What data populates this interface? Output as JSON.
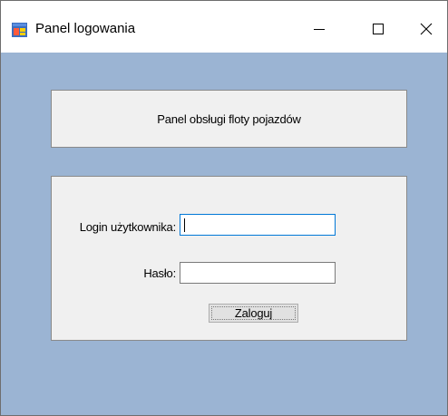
{
  "window": {
    "title": "Panel logowania",
    "icon": "windows-forms-app-icon",
    "controls": {
      "minimize": "minimize-icon",
      "maximize": "maximize-icon",
      "close": "close-icon"
    },
    "colors": {
      "client_background": "#9bb4d3",
      "panel_background": "#f0f0f0",
      "focus_border": "#0078d7"
    }
  },
  "header_panel": {
    "text": "Panel obsługi floty pojazdów"
  },
  "login_panel": {
    "login_label": "Login użytkownika:",
    "login_value": "",
    "password_label": "Hasło:",
    "password_value": "",
    "submit_label": "Zaloguj"
  }
}
